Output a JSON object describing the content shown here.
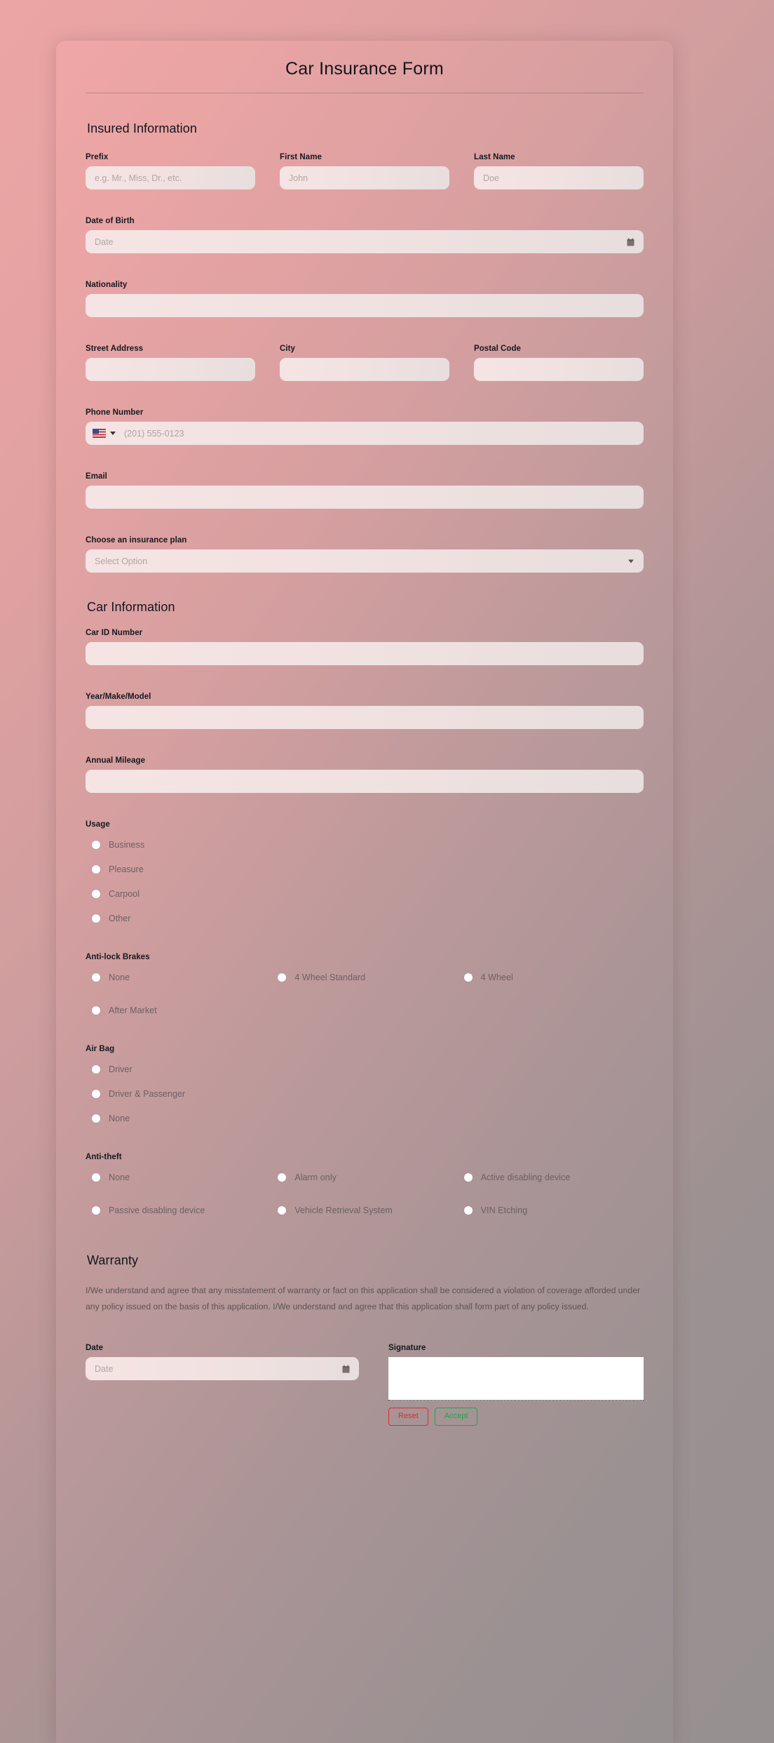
{
  "header": {
    "title": "Car Insurance Form"
  },
  "sections": {
    "insured": {
      "heading": "Insured Information",
      "prefix": {
        "label": "Prefix",
        "placeholder": "e.g. Mr., Miss, Dr., etc.",
        "value": ""
      },
      "first_name": {
        "label": "First Name",
        "placeholder": "John",
        "value": ""
      },
      "last_name": {
        "label": "Last Name",
        "placeholder": "Doe",
        "value": ""
      },
      "dob": {
        "label": "Date of Birth",
        "placeholder": "Date",
        "value": "",
        "icon": "calendar-icon"
      },
      "nationality": {
        "label": "Nationality",
        "placeholder": "",
        "value": ""
      },
      "street_address": {
        "label": "Street Address",
        "placeholder": "",
        "value": ""
      },
      "city": {
        "label": "City",
        "placeholder": "",
        "value": ""
      },
      "postal_code": {
        "label": "Postal Code",
        "placeholder": "",
        "value": ""
      },
      "phone": {
        "label": "Phone Number",
        "placeholder": "(201) 555-0123",
        "value": "",
        "country_flag": "us-flag-icon"
      },
      "email": {
        "label": "Email",
        "placeholder": "",
        "value": ""
      },
      "plan": {
        "label": "Choose an insurance plan",
        "selected": "Select Option",
        "icon": "chevron-down-icon"
      }
    },
    "car": {
      "heading": "Car Information",
      "car_id": {
        "label": "Car ID Number",
        "placeholder": "",
        "value": ""
      },
      "year_make_model": {
        "label": "Year/Make/Model",
        "placeholder": "",
        "value": ""
      },
      "annual_mileage": {
        "label": "Annual Mileage",
        "placeholder": "",
        "value": ""
      },
      "usage": {
        "label": "Usage",
        "options": [
          "Business",
          "Pleasure",
          "Carpool",
          "Other"
        ]
      },
      "antilock_brakes": {
        "label": "Anti-lock Brakes",
        "options": [
          "None",
          "4 Wheel Standard",
          "4 Wheel",
          "After Market"
        ]
      },
      "air_bag": {
        "label": "Air Bag",
        "options": [
          "Driver",
          "Driver & Passenger",
          "None"
        ]
      },
      "anti_theft": {
        "label": "Anti-theft",
        "options": [
          "None",
          "Alarm only",
          "Active disabling device",
          "Passive disabling device",
          "Vehicle Retrieval System",
          "VIN Etching"
        ]
      }
    },
    "warranty": {
      "heading": "Warranty",
      "body": "I/We understand and agree that any misstatement of warranty or fact on this application shall be considered a violation of coverage afforded under any policy issued on the basis of this application. I/We understand and agree that this application shall form part of any policy issued."
    },
    "signoff": {
      "date": {
        "label": "Date",
        "placeholder": "Date",
        "value": "",
        "icon": "calendar-icon"
      },
      "signature": {
        "label": "Signature",
        "reset_label": "Reset",
        "accept_label": "Accept"
      }
    }
  },
  "colors": {
    "accent_reset": "#e02b2b",
    "accent_accept": "#16a84a",
    "input_bg": "#f2e3e2",
    "card_pink": "#efa6a6",
    "card_gray": "#969091"
  }
}
